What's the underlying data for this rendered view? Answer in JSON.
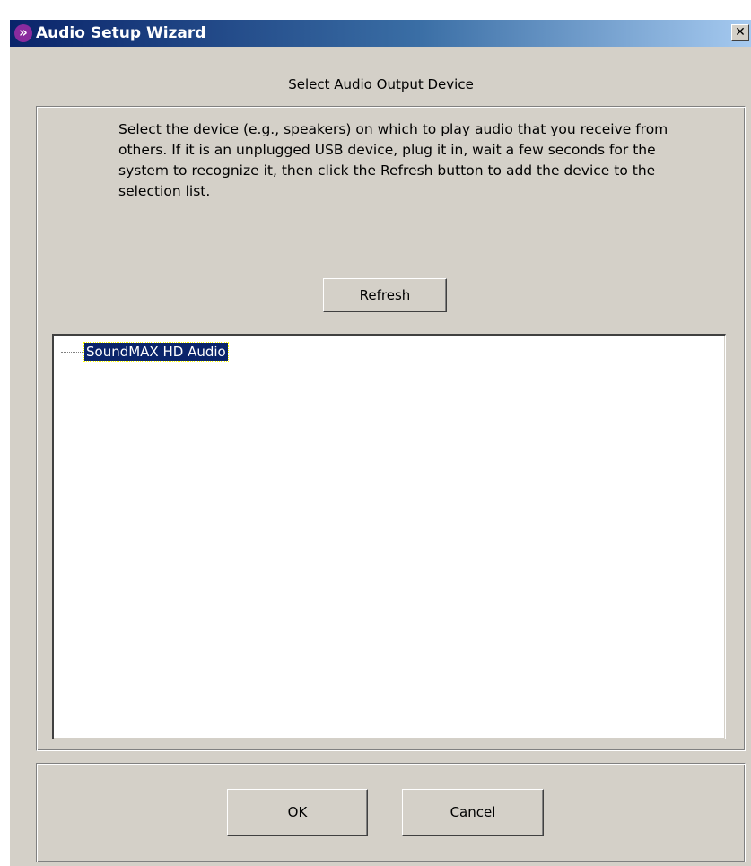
{
  "window": {
    "title": "Audio Setup Wizard",
    "app_icon_glyph": "»",
    "close_glyph": "✕",
    "icons": {
      "app": "wizard-app-icon",
      "close": "close-icon"
    },
    "colors": {
      "title_bar_start": "#0a246a",
      "title_bar_end": "#a6caf0",
      "face": "#d4d0c8",
      "selection": "#0a246a"
    }
  },
  "page": {
    "heading": "Select Audio Output Device",
    "instructions": "Select the device (e.g., speakers) on which to play audio that you receive from others. If it is an unplugged USB device, plug it in, wait a few seconds for the system to recognize it, then click the Refresh button to add the device to the selection list.",
    "refresh_label": "Refresh"
  },
  "device_tree": {
    "items": [
      {
        "label": "SoundMAX HD Audio",
        "selected": true
      }
    ]
  },
  "footer": {
    "ok_label": "OK",
    "cancel_label": "Cancel"
  }
}
